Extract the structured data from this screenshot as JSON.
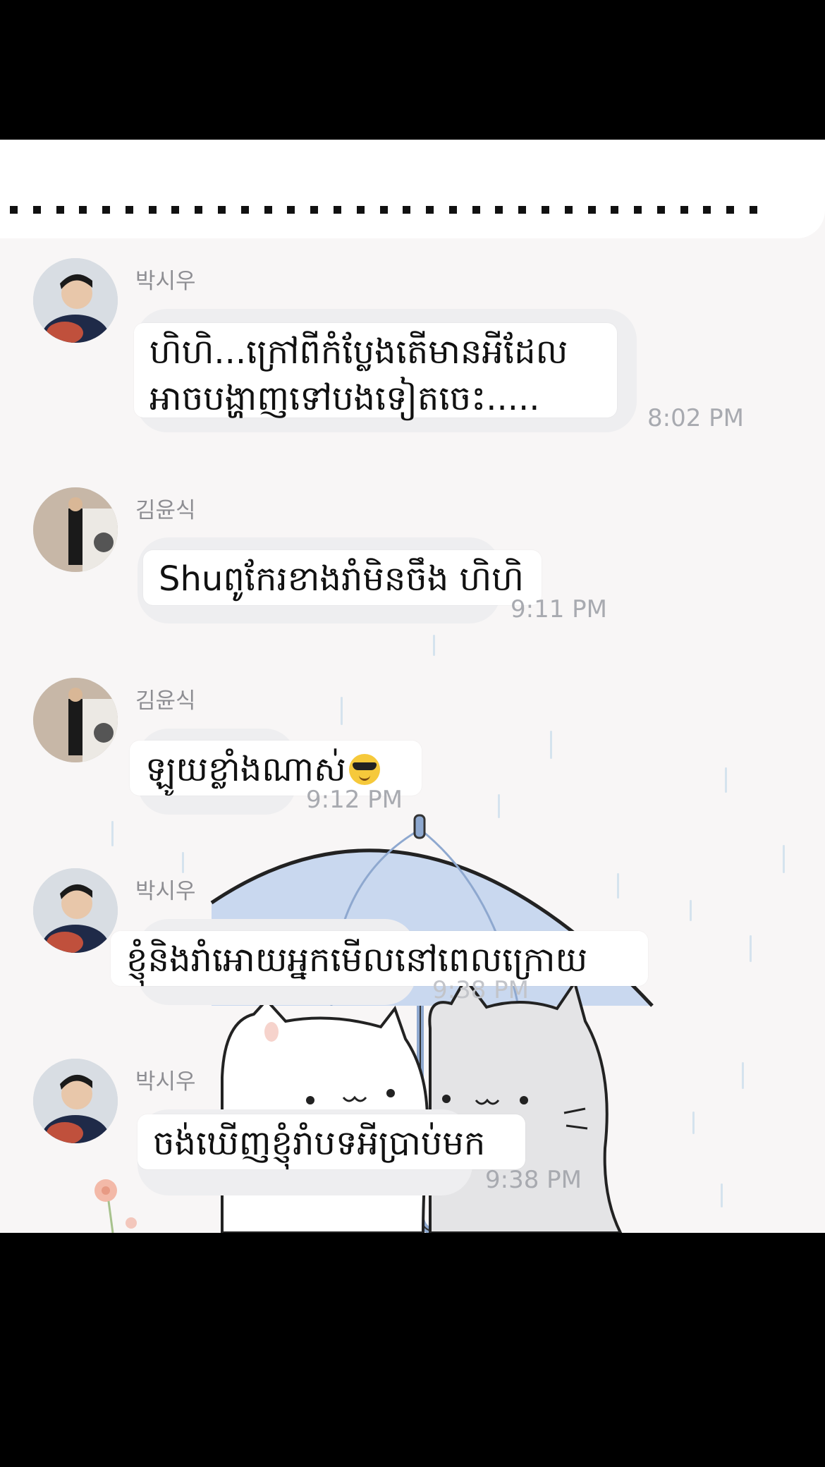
{
  "messages": [
    {
      "sender": "박시우",
      "text_lines": [
        "ហិហិ...ក្រៅពីកំប្លែងតើមានអីដែល",
        "អាចបង្ហាញទៅបងទៀតចេះ....."
      ],
      "time": "8:02 PM",
      "avatar": "boy-portrait-avatar"
    },
    {
      "sender": "김윤식",
      "text_lines": [
        "Shuពូកែរខាងរាំមិនចឹង ហិហិ"
      ],
      "time": "9:11 PM",
      "avatar": "man-street-avatar"
    },
    {
      "sender": "김윤식",
      "text_lines": [
        "ឡូយខ្លាំងណាស់"
      ],
      "emoji": "smiling-face-with-sunglasses-icon",
      "time": "9:12 PM",
      "avatar": "man-street-avatar"
    },
    {
      "sender": "박시우",
      "text_lines": [
        "ខ្ញុំនិងរាំអោយអ្នកមើលនៅពេលក្រោយ"
      ],
      "time": "9:38 PM",
      "avatar": "boy-portrait-avatar"
    },
    {
      "sender": "박시우",
      "text_lines": [
        "ចង់ឃើញខ្ញុំរាំបទអីប្រាប់មក"
      ],
      "time": "9:38 PM",
      "avatar": "boy-portrait-avatar"
    }
  ],
  "colors": {
    "background": "#f8f6f6",
    "bubble": "#ffffff",
    "ghost_bubble": "#eeeef0",
    "sender_text": "#8e8e93",
    "time_text": "#a8aab0",
    "umbrella": "#c3d4ec"
  }
}
